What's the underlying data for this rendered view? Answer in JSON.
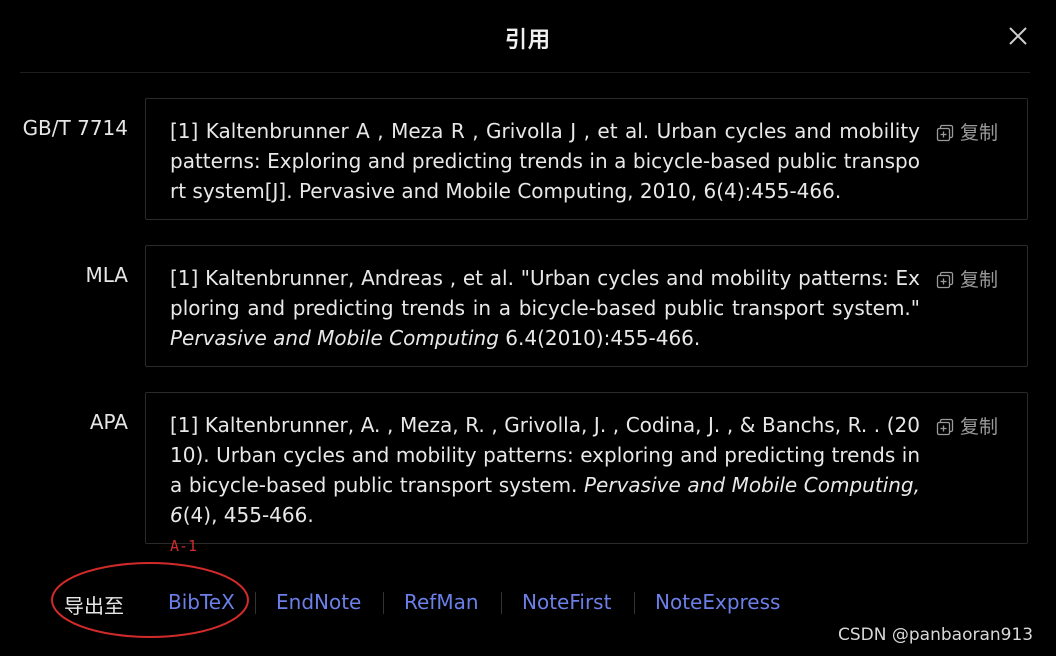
{
  "dialog": {
    "title": "引用",
    "close_icon": "close-icon"
  },
  "citations": [
    {
      "style": "GB/T 7714",
      "text_plain": "[1] Kaltenbrunner A , Meza R , Grivolla J , et al. Urban cycles and mobility patterns: Exploring and predicting trends in a bicycle-based public transport system[J]. Pervasive and Mobile Computing, 2010, 6(4):455-466.",
      "copy_label": "复制"
    },
    {
      "style": "MLA",
      "text_before": "[1] Kaltenbrunner, Andreas , et al. \"Urban cycles and mobility patterns: Exploring and predicting trends in a bicycle-based public transport system.\" ",
      "text_italic": "Pervasive and Mobile Computing",
      "text_after": " 6.4(2010):455-466.",
      "copy_label": "复制"
    },
    {
      "style": "APA",
      "text_before": "[1] Kaltenbrunner, A. , Meza, R. , Grivolla, J. , Codina, J. , & Banchs, R. . (2010). Urban cycles and mobility patterns: exploring and predicting trends in a bicycle-based public transport system. ",
      "text_italic": "Pervasive and Mobile Computing, 6",
      "text_after": "(4), 455-466.",
      "copy_label": "复制"
    }
  ],
  "export": {
    "label": "导出至",
    "links": [
      "BibTeX",
      "EndNote",
      "RefMan",
      "NoteFirst",
      "NoteExpress"
    ]
  },
  "annotation": {
    "label": "A-1",
    "color": "#d12a2a"
  },
  "watermark": "CSDN @panbaoran913",
  "colors": {
    "background": "#000000",
    "link": "#6c7fe8",
    "text": "#e8e8e8",
    "muted": "#9a9a9a"
  }
}
